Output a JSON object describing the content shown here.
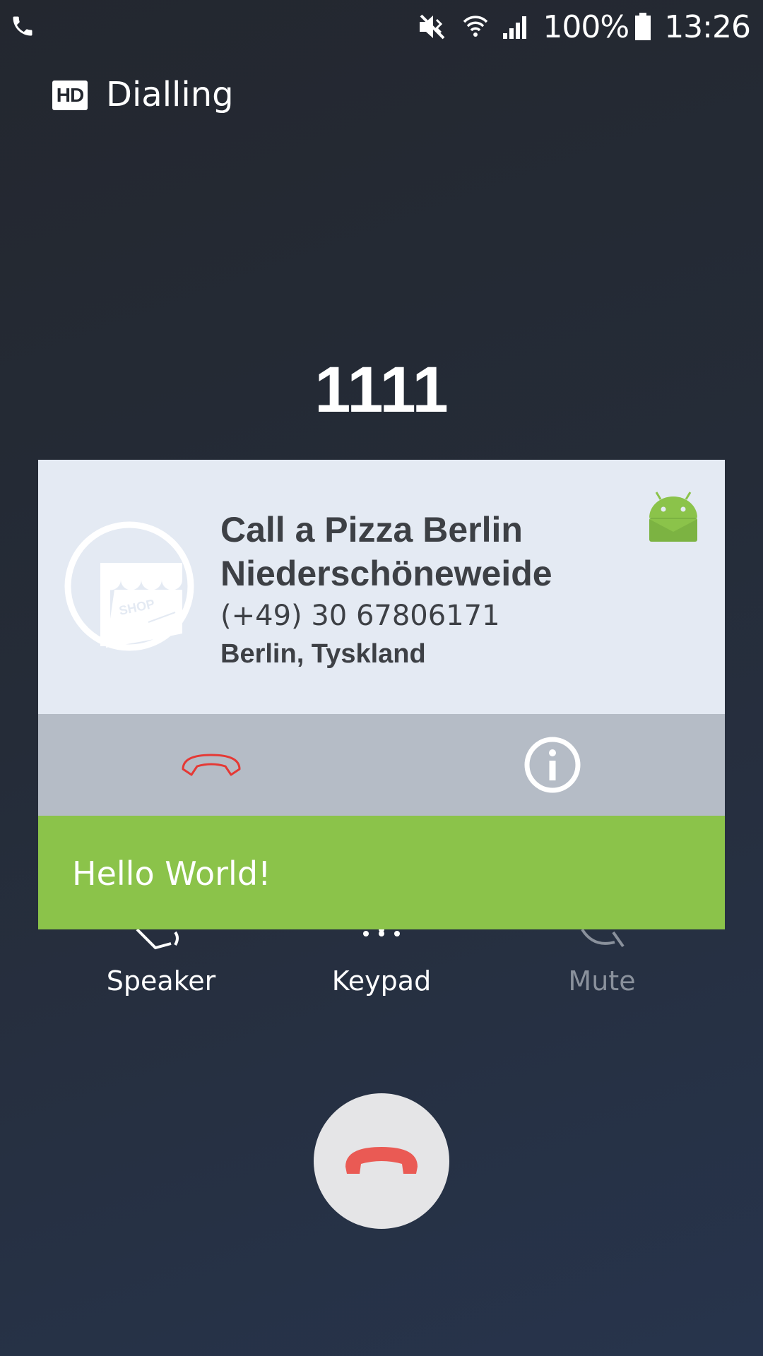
{
  "status_bar": {
    "battery": "100%",
    "time": "13:26"
  },
  "call": {
    "hd_label": "HD",
    "state": "Dialling",
    "number": "1111"
  },
  "overlay": {
    "name": "Call a Pizza Berlin Niederschöneweide",
    "phone": "(+49) 30 67806171",
    "location": "Berlin, Tyskland",
    "shop_sign": "SHOP",
    "message": "Hello World!",
    "colors": {
      "card_background": "#e4eaf3",
      "actions_background": "#b5bcc6",
      "message_background": "#8bc34a",
      "hangup_red": "#e53935"
    }
  },
  "controls": {
    "speaker_label": "Speaker",
    "keypad_label": "Keypad",
    "mute_label": "Mute"
  },
  "icons": {
    "status": [
      "phone-icon",
      "mute-icon",
      "wifi-icon",
      "signal-icon",
      "battery-icon"
    ],
    "overlay": [
      "shop-icon",
      "android-icon",
      "hangup-icon",
      "info-icon"
    ],
    "controls": [
      "speaker-icon",
      "keypad-icon",
      "mute-icon",
      "end-call-icon"
    ]
  }
}
